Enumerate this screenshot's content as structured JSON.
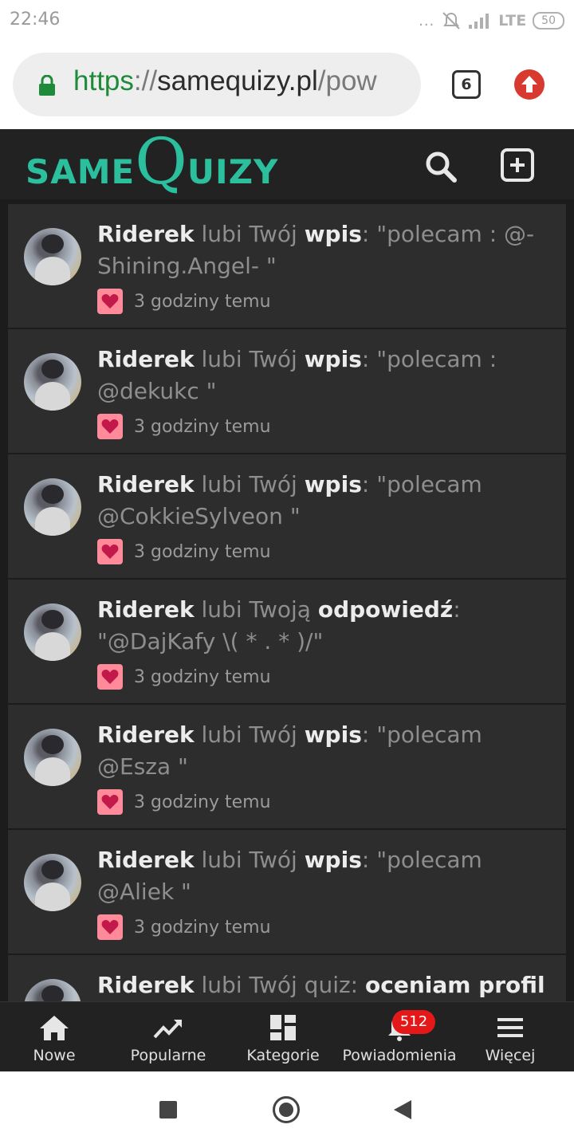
{
  "status_bar": {
    "time": "22:46",
    "signal_dots": "...",
    "network": "LTE",
    "battery": "50"
  },
  "browser": {
    "url_scheme": "https",
    "url_separator": "://",
    "url_host": "samequizy.pl",
    "url_path": "/pow",
    "tab_count": "6"
  },
  "header": {
    "logo_same": "SAME",
    "logo_q": "Q",
    "logo_uizy": "UIZY",
    "accent_color": "#2bbf9e"
  },
  "notifications": [
    {
      "user": "Riderek",
      "action": " lubi Twój ",
      "object": "wpis",
      "text": ": \"polecam : @-Shining.Angel- \"",
      "extra": "",
      "time": "3 godziny temu"
    },
    {
      "user": "Riderek",
      "action": " lubi Twój ",
      "object": "wpis",
      "text": ": \"polecam : @dekukc \"",
      "extra": "",
      "time": "3 godziny temu"
    },
    {
      "user": "Riderek",
      "action": " lubi Twój ",
      "object": "wpis",
      "text": ": \"polecam @CokkieSylveon \"",
      "extra": "",
      "time": "3 godziny temu"
    },
    {
      "user": "Riderek",
      "action": " lubi Twoją ",
      "object": "odpowiedź",
      "text": ": \"@DajKafy \\( * . * )/\"",
      "extra": "",
      "time": "3 godziny temu"
    },
    {
      "user": "Riderek",
      "action": " lubi Twój ",
      "object": "wpis",
      "text": ": \"polecam @Esza \"",
      "extra": "",
      "time": "3 godziny temu"
    },
    {
      "user": "Riderek",
      "action": " lubi Twój ",
      "object": "wpis",
      "text": ": \"polecam @Aliek \"",
      "extra": "",
      "time": "3 godziny temu"
    },
    {
      "user": "Riderek",
      "action": " lubi Twój quiz: ",
      "object": "",
      "text": "",
      "extra": "oceniam profil",
      "time": ""
    }
  ],
  "bottom_nav": {
    "items": [
      {
        "label": "Nowe",
        "icon": "home-icon"
      },
      {
        "label": "Popularne",
        "icon": "trending-icon"
      },
      {
        "label": "Kategorie",
        "icon": "dashboard-icon"
      },
      {
        "label": "Powiadomienia",
        "icon": "bell-icon",
        "badge": "512"
      },
      {
        "label": "Więcej",
        "icon": "menu-icon"
      }
    ]
  }
}
